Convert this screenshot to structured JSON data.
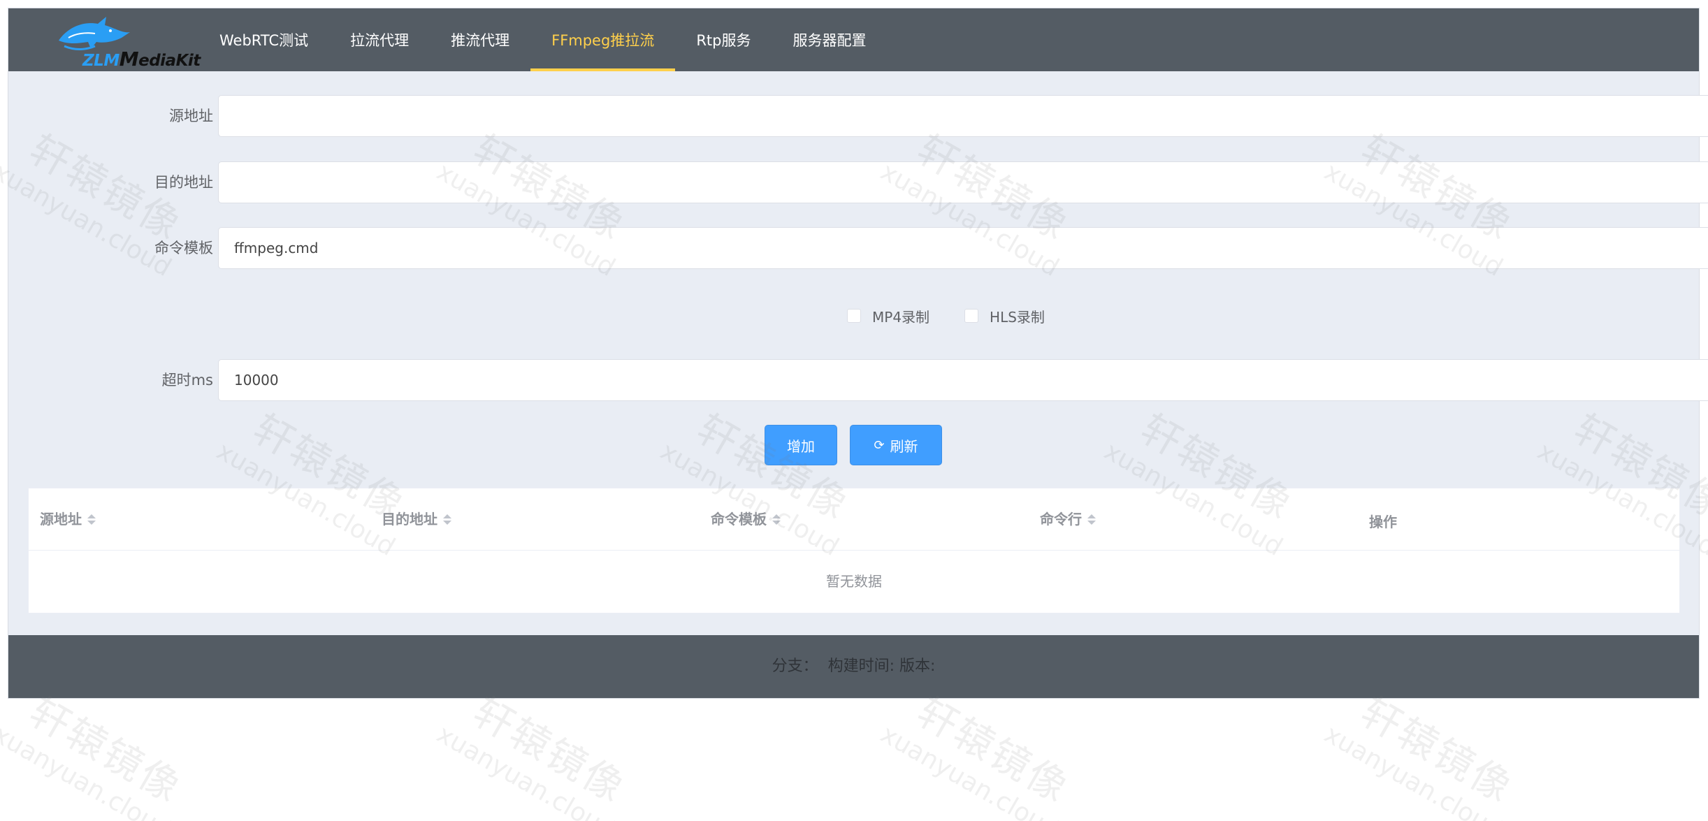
{
  "app": {
    "logo_text_1": "ZLM",
    "logo_text_2": "ediaKit"
  },
  "nav": {
    "items": [
      {
        "label": "WebRTC测试"
      },
      {
        "label": "拉流代理"
      },
      {
        "label": "推流代理"
      },
      {
        "label": "FFmpeg推拉流",
        "active": true
      },
      {
        "label": "Rtp服务"
      },
      {
        "label": "服务器配置"
      }
    ]
  },
  "colors": {
    "header_bg": "#545c64",
    "active_nav": "#ffd04b",
    "primary": "#409eff"
  },
  "form": {
    "src": {
      "label": "源地址",
      "value": ""
    },
    "dst": {
      "label": "目的地址",
      "value": ""
    },
    "cmd": {
      "label": "命令模板",
      "value": "ffmpeg.cmd"
    },
    "mp4": {
      "label": "MP4录制",
      "checked": false
    },
    "hls": {
      "label": "HLS录制",
      "checked": false
    },
    "timeout": {
      "label": "超时ms",
      "value": "10000"
    }
  },
  "buttons": {
    "add": "增加",
    "refresh": "刷新",
    "refresh_icon": "refresh-icon"
  },
  "table": {
    "columns": [
      {
        "label": "源地址",
        "sortable": true
      },
      {
        "label": "目的地址",
        "sortable": true
      },
      {
        "label": "命令模板",
        "sortable": true
      },
      {
        "label": "命令行",
        "sortable": true
      },
      {
        "label": "操作",
        "sortable": false
      }
    ],
    "rows": [],
    "empty_text": "暂无数据"
  },
  "footer": {
    "text": "分支：  构建时间: 版本:"
  },
  "watermark": {
    "cn": "轩辕镜像",
    "en": "xuanyuan.cloud"
  }
}
